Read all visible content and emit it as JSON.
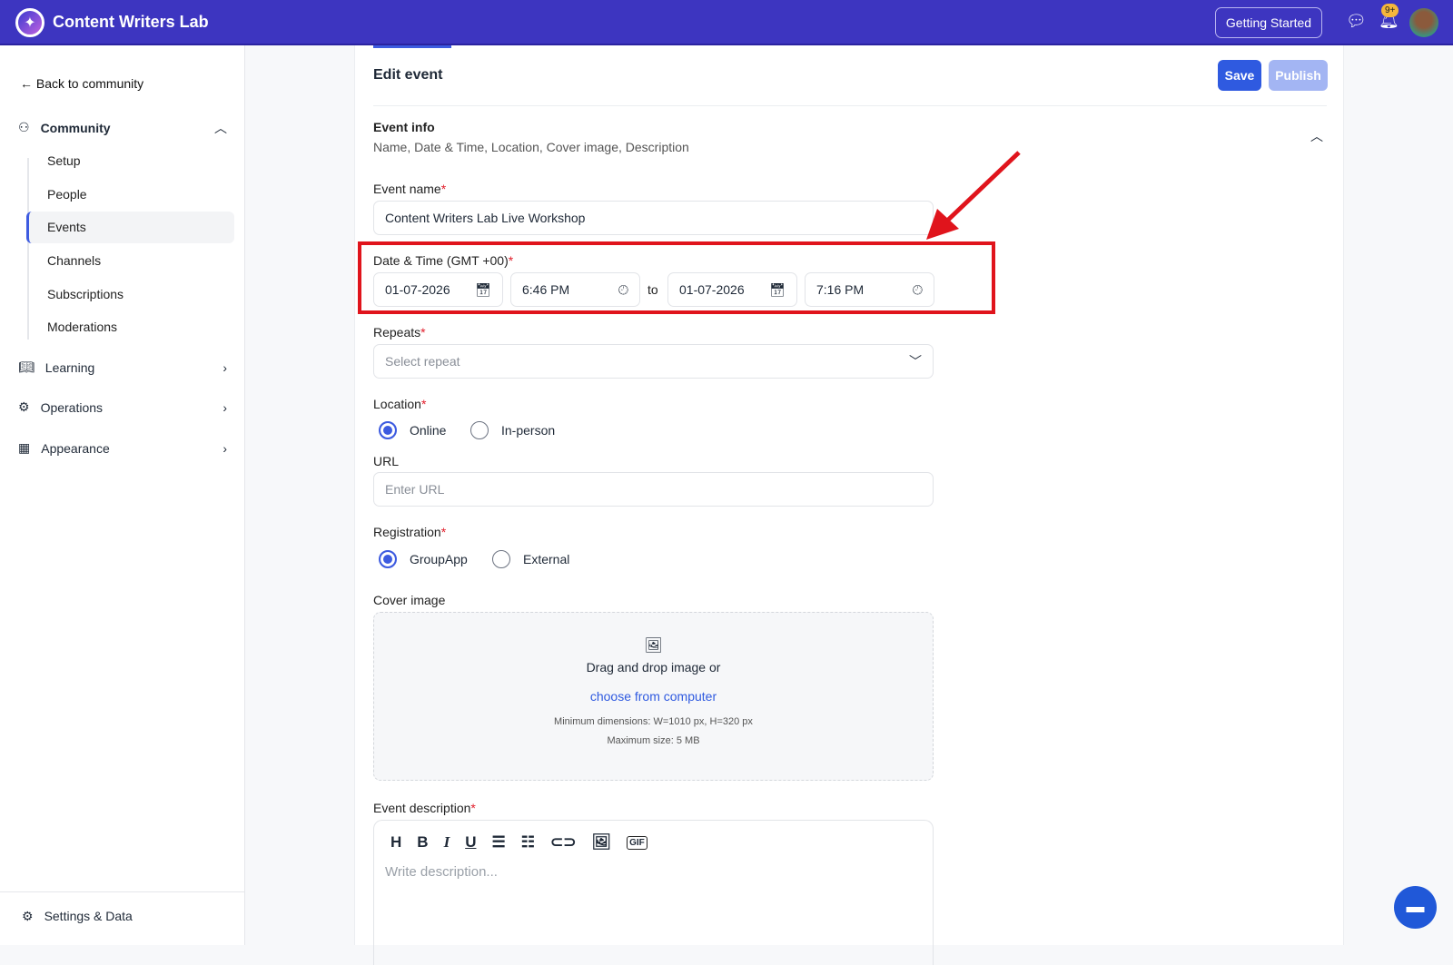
{
  "header": {
    "brand": "Content Writers Lab",
    "getting_started": "Getting Started",
    "notif_badge": "9+"
  },
  "sidebar": {
    "back": "Back to community",
    "community": "Community",
    "sub_items": [
      "Setup",
      "People",
      "Events",
      "Channels",
      "Subscriptions",
      "Moderations"
    ],
    "sections": [
      "Learning",
      "Operations",
      "Appearance"
    ],
    "settings": "Settings & Data"
  },
  "main": {
    "title": "Edit event",
    "save": "Save",
    "publish": "Publish",
    "event_info": {
      "title": "Event info",
      "subtitle": "Name, Date & Time, Location, Cover image, Description"
    },
    "event_name": {
      "label": "Event name",
      "value": "Content Writers Lab Live Workshop"
    },
    "datetime": {
      "label": "Date & Time (GMT +00)",
      "start_date": "01-07-2026",
      "start_time": "6:46 PM",
      "to": "to",
      "end_date": "01-07-2026",
      "end_time": "7:16 PM"
    },
    "repeats": {
      "label": "Repeats",
      "placeholder": "Select repeat"
    },
    "location": {
      "label": "Location",
      "options": [
        "Online",
        "In-person"
      ]
    },
    "url": {
      "label": "URL",
      "placeholder": "Enter URL"
    },
    "registration": {
      "label": "Registration",
      "options": [
        "GroupApp",
        "External"
      ]
    },
    "cover": {
      "label": "Cover image",
      "drag": "Drag and drop image or",
      "choose": "choose from computer",
      "min": "Minimum dimensions: W=1010 px, H=320 px",
      "max": "Maximum size: 5 MB"
    },
    "description": {
      "label": "Event description",
      "placeholder": "Write description...",
      "toolbar": [
        "H",
        "B",
        "I",
        "U"
      ]
    }
  },
  "colors": {
    "accent": "#3d5be0",
    "header": "#3d35c0",
    "highlight": "#e0141c"
  }
}
